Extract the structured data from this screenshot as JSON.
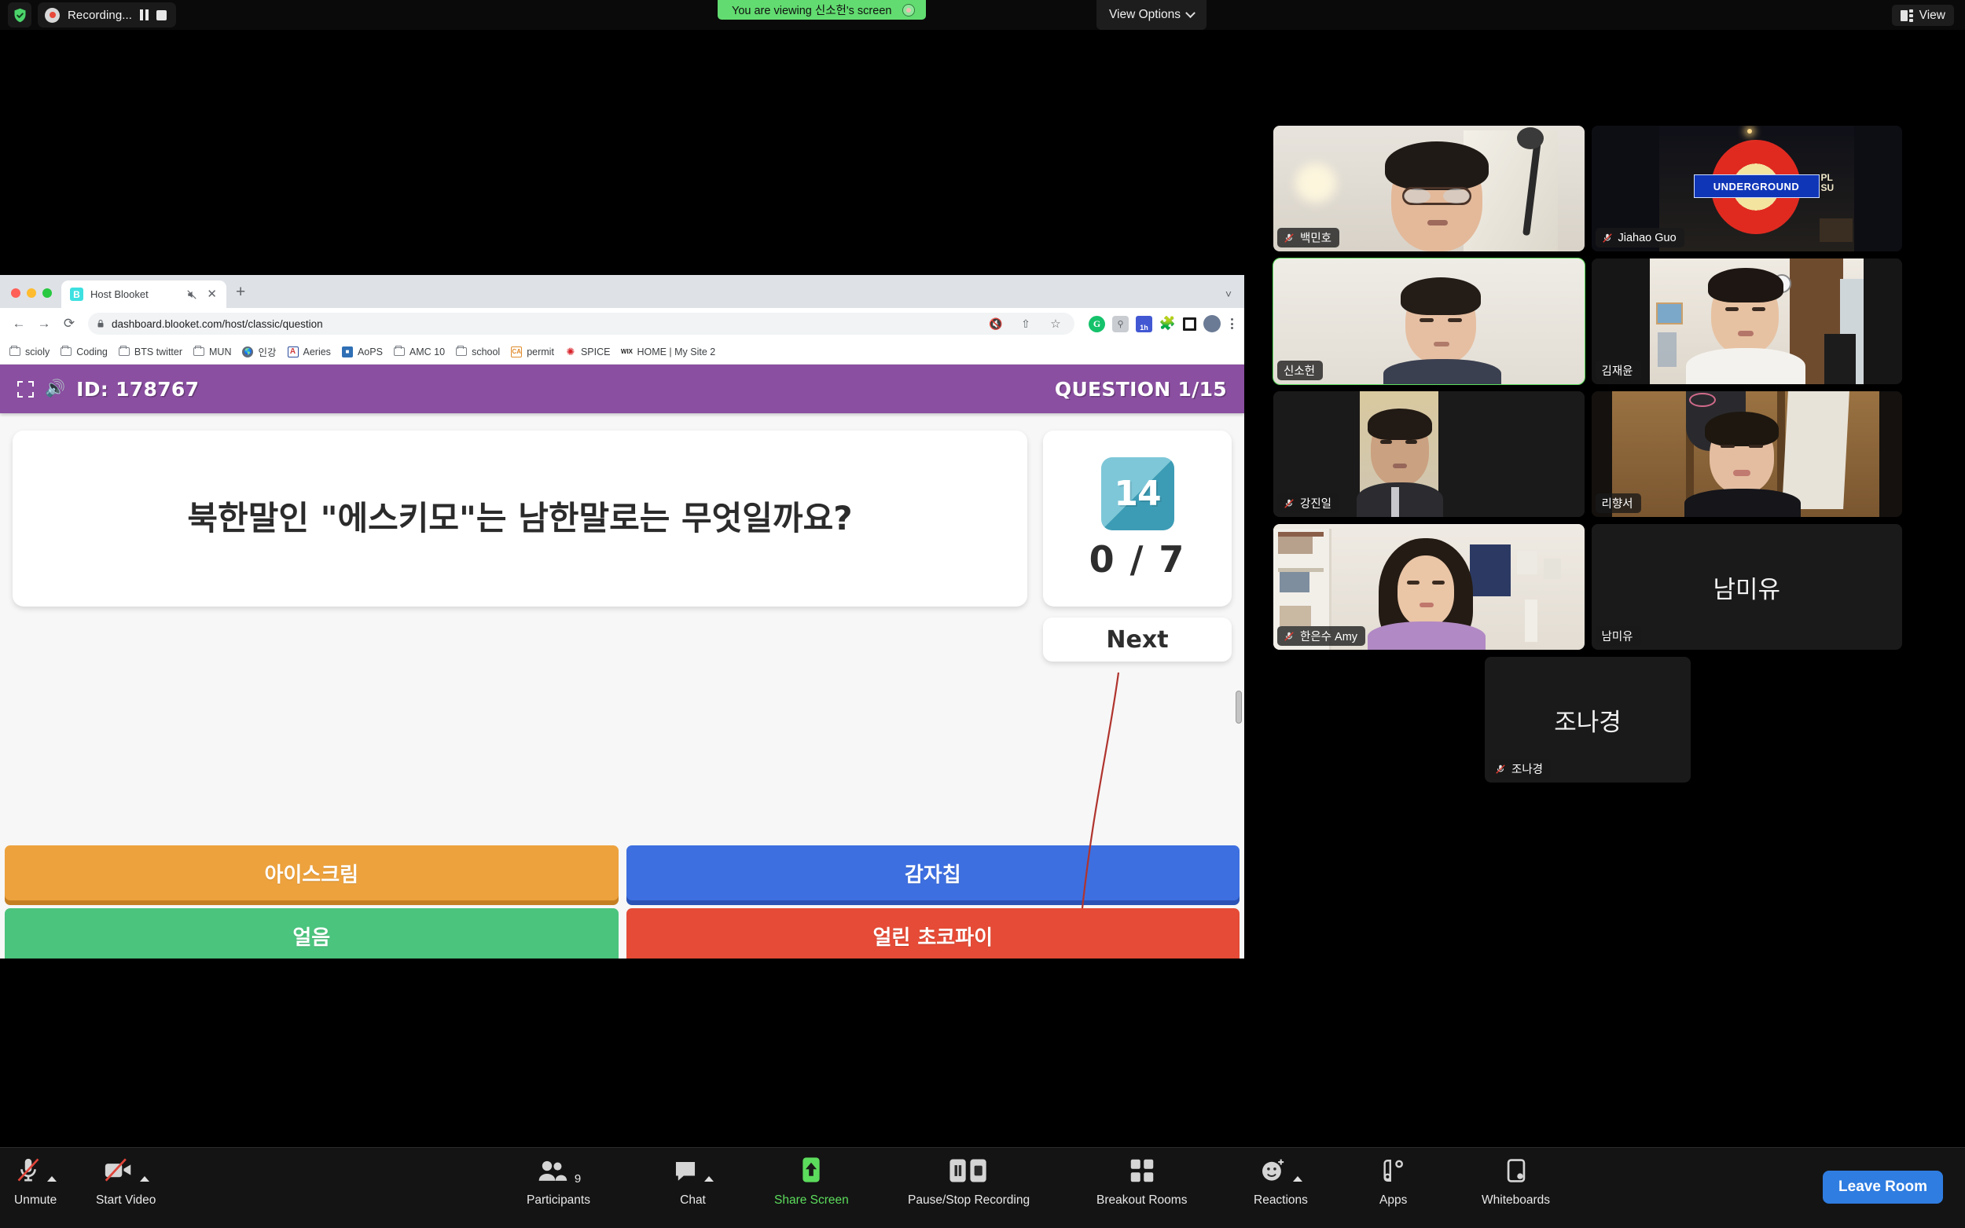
{
  "zoom_top": {
    "recording_label": "Recording...",
    "pause_icon": "pause-icon",
    "stop_icon": "stop-icon",
    "shield_icon": "encryption-shield-icon",
    "record_dot_icon": "record-dot-icon",
    "viewing_banner": "You are viewing 신소헌's screen",
    "view_options_label": "View Options",
    "view_button_label": "View"
  },
  "browser": {
    "tab_title": "Host Blooket",
    "tab_favicon_letter": "B",
    "tab_muted_icon": "speaker-muted-icon",
    "tab_close_icon": "close-icon",
    "new_tab_icon": "plus-icon",
    "tabstrip_caret_icon": "chevron-down-icon",
    "back_icon": "back-arrow-icon",
    "forward_icon": "forward-arrow-icon",
    "reload_icon": "reload-icon",
    "lock_icon": "lock-icon",
    "url_domain": "dashboard.blooket.com",
    "url_path": "/host/classic/question",
    "url_full": "dashboard.blooket.com/host/classic/question",
    "omnibox_icons": [
      "mute-site-icon",
      "share-icon",
      "bookmark-star-icon"
    ],
    "extension_icons": [
      "grammarly-icon",
      "gray-extension-icon",
      "calendar-1h-icon",
      "puzzle-extensions-icon",
      "square-extension-icon",
      "profile-avatar-icon",
      "kebab-menu-icon"
    ],
    "calendar_badge": "1h",
    "bookmarks": [
      {
        "label": "scioly",
        "icon": "folder-icon"
      },
      {
        "label": "Coding",
        "icon": "folder-icon"
      },
      {
        "label": "BTS twitter",
        "icon": "folder-icon"
      },
      {
        "label": "MUN",
        "icon": "folder-icon"
      },
      {
        "label": "인강",
        "icon": "globe-icon"
      },
      {
        "label": "Aeries",
        "icon": "aeries-icon"
      },
      {
        "label": "AoPS",
        "icon": "aops-cube-icon"
      },
      {
        "label": "AMC 10",
        "icon": "folder-icon"
      },
      {
        "label": "school",
        "icon": "folder-icon"
      },
      {
        "label": "permit",
        "icon": "ca-dmv-icon"
      },
      {
        "label": "SPICE",
        "icon": "spice-gear-icon"
      },
      {
        "label": "HOME | My Site 2",
        "icon": "wix-icon"
      }
    ]
  },
  "blooket": {
    "expand_icon": "fullscreen-icon",
    "sound_icon": "sound-on-icon",
    "game_id": "ID: 178767",
    "question_progress": "QUESTION 1/15",
    "question_text": "북한말인 \"에스키모\"는 남한말로는 무엇일까요?",
    "timer_value": "14",
    "answered_count": "0 / 7",
    "next_label": "Next",
    "header_color": "#8a4fa0",
    "timer_color": "#3d9cb5",
    "answers": [
      {
        "label": "아이스크림",
        "color": "#eda23d"
      },
      {
        "label": "감자칩",
        "color": "#3d6fe0"
      },
      {
        "label": "얼음",
        "color": "#4bc47d"
      },
      {
        "label": "얼린 초코파이",
        "color": "#e54b36"
      }
    ]
  },
  "participants": [
    {
      "name": "백민호",
      "muted": true,
      "video_on": true,
      "active": false,
      "scene": "glasses"
    },
    {
      "name": "Jiahao Guo",
      "muted": true,
      "video_on": true,
      "active": false,
      "scene": "underground"
    },
    {
      "name": "신소헌",
      "muted": false,
      "video_on": true,
      "active": true,
      "scene": "plain"
    },
    {
      "name": "김재윤",
      "muted": false,
      "video_on": true,
      "active": false,
      "scene": "room"
    },
    {
      "name": "강진일",
      "muted": true,
      "video_on": true,
      "active": false,
      "scene": "portrait"
    },
    {
      "name": "리향서",
      "muted": false,
      "video_on": true,
      "active": false,
      "scene": "closet"
    },
    {
      "name": "한은수 Amy",
      "muted": true,
      "video_on": true,
      "active": false,
      "scene": "shelf"
    },
    {
      "name": "남미유",
      "muted": false,
      "video_on": false,
      "active": false,
      "scene": "none"
    },
    {
      "name": "조나경",
      "muted": true,
      "video_on": false,
      "active": false,
      "scene": "none"
    }
  ],
  "toolbar": {
    "items": [
      {
        "label": "Unmute",
        "icon": "mic-off-icon",
        "caret": true,
        "accent": "#e8e8e8"
      },
      {
        "label": "Start Video",
        "icon": "video-off-icon",
        "caret": true,
        "accent": "#e8e8e8"
      },
      {
        "label": "Participants",
        "icon": "participants-icon",
        "caret": false,
        "badge": "9",
        "accent": "#e8e8e8"
      },
      {
        "label": "Chat",
        "icon": "chat-bubble-icon",
        "caret": true,
        "accent": "#e8e8e8"
      },
      {
        "label": "Share Screen",
        "icon": "share-screen-icon",
        "caret": false,
        "accent": "#5cdc5c"
      },
      {
        "label": "Pause/Stop Recording",
        "icon": "pause-stop-recording-icon",
        "caret": false,
        "accent": "#e8e8e8"
      },
      {
        "label": "Breakout Rooms",
        "icon": "breakout-rooms-icon",
        "caret": false,
        "accent": "#e8e8e8"
      },
      {
        "label": "Reactions",
        "icon": "reactions-icon",
        "caret": true,
        "accent": "#e8e8e8"
      },
      {
        "label": "Apps",
        "icon": "apps-icon",
        "caret": false,
        "accent": "#e8e8e8"
      },
      {
        "label": "Whiteboards",
        "icon": "whiteboards-icon",
        "caret": false,
        "accent": "#e8e8e8"
      }
    ],
    "participants_count": "9",
    "leave_label": "Leave Room",
    "leave_color": "#2f7de1"
  }
}
